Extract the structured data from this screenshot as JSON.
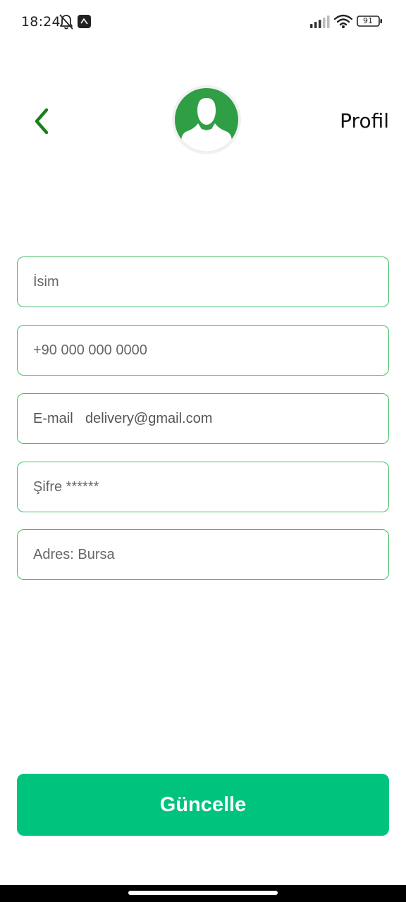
{
  "status_bar": {
    "time": "18:24",
    "battery": "91",
    "icons": [
      "bell-off-icon",
      "app-notification-icon",
      "signal-icon",
      "wifi-icon",
      "battery-icon"
    ]
  },
  "header": {
    "back_icon": "chevron-left-icon",
    "avatar_icon": "user-avatar-icon",
    "title": "Profil"
  },
  "form": {
    "name_placeholder": "İsim",
    "phone_placeholder": "+90 000 000 0000",
    "email_label": "E-mail",
    "email_value": "delivery@gmail.com",
    "password_placeholder": "Şifre ******",
    "address_placeholder": "Adres: Bursa"
  },
  "actions": {
    "update_label": "Güncelle"
  },
  "colors": {
    "accent": "#00c47e",
    "field_border": "#3fbf62",
    "back_arrow": "#1a7f1a",
    "avatar_bg": "#2f9e44"
  }
}
